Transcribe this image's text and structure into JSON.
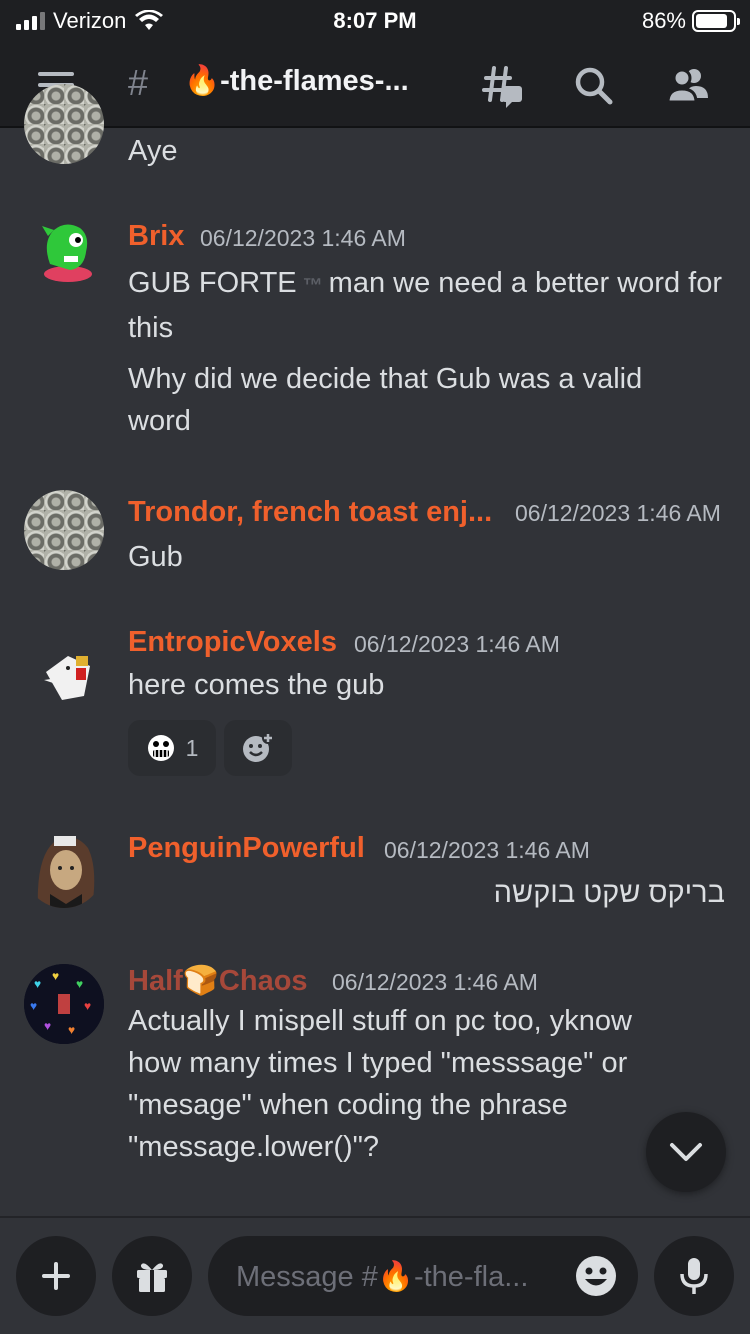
{
  "status_bar": {
    "carrier": "Verizon",
    "time": "8:07 PM",
    "battery": "86%",
    "battery_level": 0.86
  },
  "header": {
    "hash": "#",
    "channel": "🔥-the-flames-..."
  },
  "messages": [
    {
      "text": "Aye"
    },
    {
      "author": "Brix",
      "timestamp": "06/12/2023 1:46 AM",
      "lines": [
        "GUB FORTE",
        "™",
        "man we need a better word for this",
        "Why did we decide that Gub was a valid word"
      ]
    },
    {
      "author": "Trondor, french toast enj...",
      "timestamp": "06/12/2023 1:46 AM",
      "text": "Gub"
    },
    {
      "author": "EntropicVoxels",
      "timestamp": "06/12/2023 1:46 AM",
      "text": "here comes the gub",
      "reaction_count": "1"
    },
    {
      "author": "PenguinPowerful",
      "timestamp": "06/12/2023 1:46 AM",
      "text": "בריקס שקט בוקשה"
    },
    {
      "author_part1": "Half",
      "author_emoji": "🍞",
      "author_part2": "Chaos",
      "timestamp": "06/12/2023 1:46 AM",
      "text": "Actually I mispell stuff on pc too, yknow how many times I typed \"messsage\" or \"mesage\" when coding the phrase \"message.lower()\"?"
    }
  ],
  "composer": {
    "placeholder": "Message #🔥-the-fla..."
  },
  "icons": [
    "hamburger-menu-icon",
    "threads-icon",
    "search-icon",
    "members-icon",
    "plus-icon",
    "gift-icon",
    "emoji-icon",
    "microphone-icon",
    "chevron-down-icon",
    "add-reaction-icon"
  ],
  "colors": {
    "background": "#313338",
    "header": "#1e1f22",
    "username": "#f0602c",
    "text": "#dbdee1",
    "muted": "#b5bac1"
  }
}
